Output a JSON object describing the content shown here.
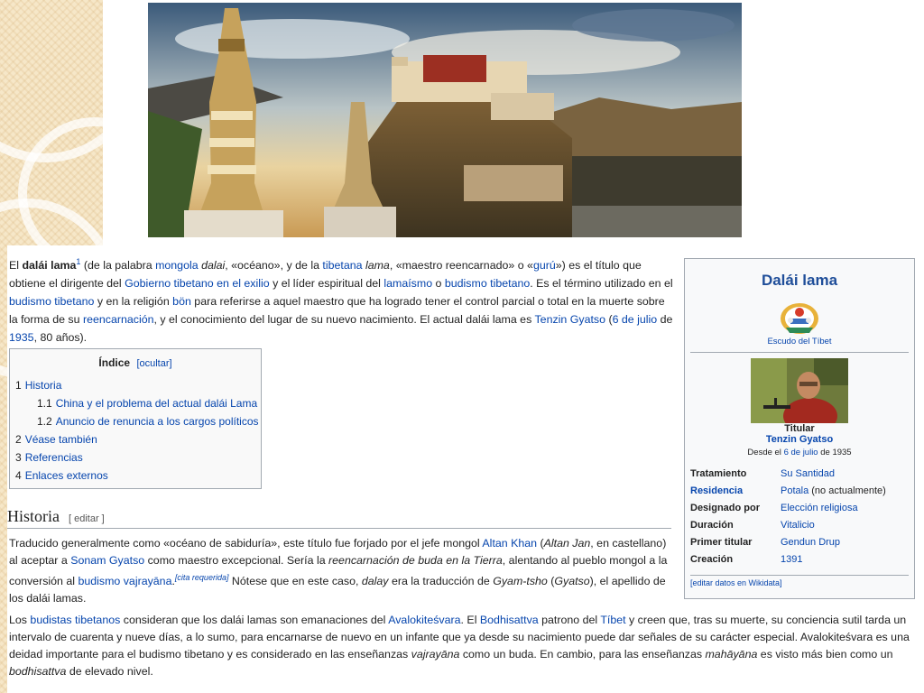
{
  "colors": {
    "link": "#0645ad",
    "infobox_title": "#1f4e99",
    "border": "#a2a9b1",
    "deco_bg": "#f6e7c8"
  },
  "banner": {
    "icon": "potala-palace-photo"
  },
  "lead": {
    "t1": "El ",
    "term": "dalái lama",
    "ref": "1",
    "t2": " (de la palabra ",
    "l_mongola": "mongola",
    "t3": " ",
    "dalai": "dalai",
    "t4": ", «océano», y de la ",
    "l_tibetana": "tibetana",
    "t5": " ",
    "lama": "lama",
    "t6": ", «maestro reencarnado» o «",
    "l_guru": "gurú",
    "t7": "») es el título que obtiene el dirigente del ",
    "l_gobierno": "Gobierno tibetano en el exilio",
    "t8": " y el líder espiritual del ",
    "l_lamaismo": "lamaísmo",
    "t9": " o ",
    "l_budismo1": "budismo tibetano",
    "t10": ". Es el término utilizado en el ",
    "l_budismo2": "budismo tibetano",
    "t11": " y en la religión ",
    "l_bon": "bön",
    "t12": " para referirse a aquel maestro que ha logrado tener el control parcial o total en la muerte sobre la forma de su ",
    "l_reencarnacion": "reencarnación",
    "t13": ", y el conocimiento del lugar de su nuevo nacimiento. El actual dalái lama es ",
    "l_tenzin": "Tenzin Gyatso",
    "t14": " (",
    "l_fecha": "6 de julio",
    "t15": " de ",
    "l_1935": "1935",
    "t16": ", 80 años)."
  },
  "toc": {
    "title": "Índice",
    "toggle": "[ocultar]",
    "items": [
      {
        "num": "1",
        "label": "Historia"
      },
      {
        "num": "1.1",
        "label": "China y el problema del actual dalái Lama"
      },
      {
        "num": "1.2",
        "label": "Anuncio de renuncia a los cargos políticos"
      },
      {
        "num": "2",
        "label": "Véase también"
      },
      {
        "num": "3",
        "label": "Referencias"
      },
      {
        "num": "4",
        "label": "Enlaces externos"
      }
    ]
  },
  "section": {
    "title": "Historia",
    "edit": "[ editar ]"
  },
  "p1": {
    "t1": "Traducido generalmente como «océano de sabiduría», este título fue forjado por el jefe mongol ",
    "l_altan": "Altan Khan",
    "t2": " (",
    "altan_jan": "Altan Jan",
    "t3": ", en castellano) al aceptar a ",
    "l_sonam": "Sonam Gyatso",
    "t4": " como maestro excepcional. Sería la ",
    "reenc": "reencarnación de buda en la Tierra",
    "t5": ", alentando al pueblo mongol a la conversión al ",
    "l_vajra": "budismo vajrayāna",
    "t6": ".",
    "cita": "[cita requerida]",
    "t7": " Nótese que en este caso, ",
    "dalay": "dalay",
    "t8": " era la traducción de ",
    "gyam": "Gyam-tsho",
    "t9": " (",
    "gyatso": "Gyatso",
    "t10": "), el apellido de los dalái lamas."
  },
  "p2": {
    "t1": "Los ",
    "l_budistas": "budistas tibetanos",
    "t2": " consideran que los dalái lamas son emanaciones del ",
    "l_avalo": "Avalokiteśvara",
    "t3": ". El ",
    "l_bodhi": "Bodhisattva",
    "t4": " patrono del ",
    "l_tibet": "Tíbet",
    "t5": " y creen que, tras su muerte, su conciencia sutil tarda un intervalo de cuarenta y nueve días, a lo sumo, para encarnarse de nuevo en un infante que ya desde su nacimiento puede dar señales de su carácter especial. Avalokiteśvara es una deidad importante para el budismo tibetano y es considerado en las enseñanzas ",
    "vajrayana": "vajrayāna",
    "t6": " como un buda. En cambio, para las enseñanzas ",
    "mahayana": "mahāyāna",
    "t7": " es visto más bien como un ",
    "bodhisattva": "bodhisattva",
    "t8": " de elevado nivel."
  },
  "infobox": {
    "title": "Dalái lama",
    "emblem_icon": "tibet-coat-of-arms-icon",
    "emblem_caption": "Escudo del Tíbet",
    "photo_icon": "tenzin-gyatso-photo",
    "role": "Titular",
    "holder": "Tenzin Gyatso",
    "since_t1": "Desde el ",
    "since_link": "6 de julio",
    "since_t2": " de 1935",
    "rows": [
      {
        "key": "Tratamiento",
        "value": "Su Santidad"
      },
      {
        "key": "Residencia",
        "value": "Potala",
        "extra": " (no actualmente)"
      },
      {
        "key": "Designado por",
        "value": "Elección religiosa"
      },
      {
        "key": "Duración",
        "value": "Vitalicio"
      },
      {
        "key": "Primer titular",
        "value": "Gendun Drup"
      },
      {
        "key": "Creación",
        "value": "1391"
      }
    ],
    "footer": "[editar datos en Wikidata]"
  }
}
